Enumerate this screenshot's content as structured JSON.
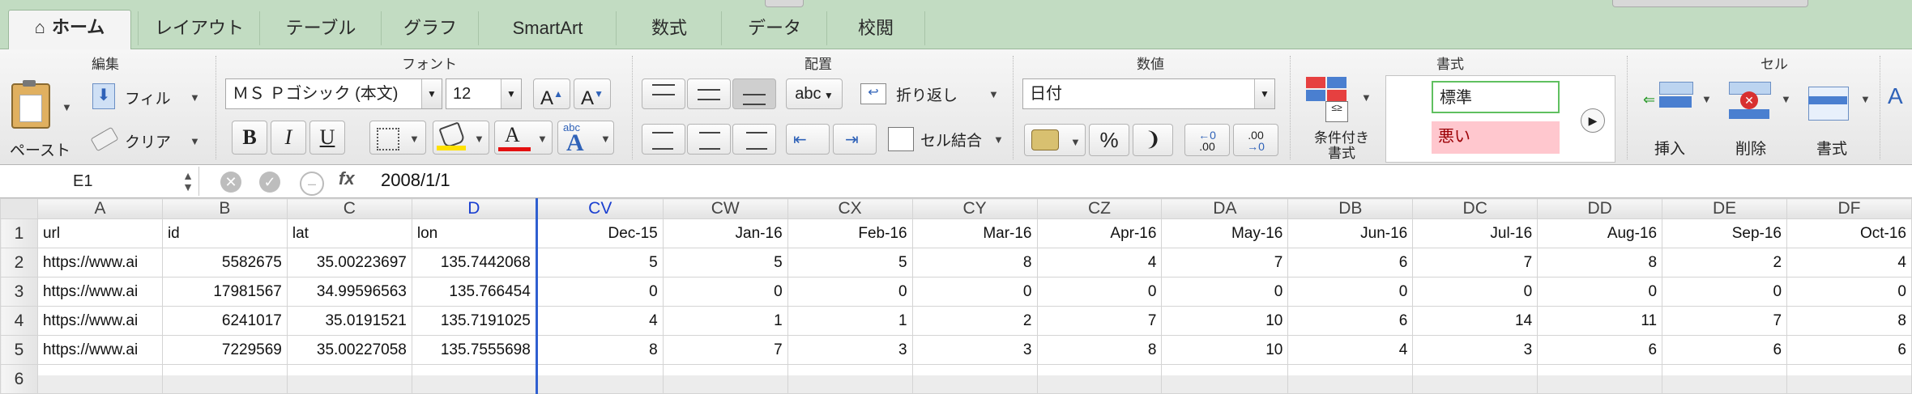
{
  "tabs": [
    "ホーム",
    "レイアウト",
    "テーブル",
    "グラフ",
    "SmartArt",
    "数式",
    "データ",
    "校閲"
  ],
  "ribbon": {
    "groups": {
      "edit": "編集",
      "font": "フォント",
      "align": "配置",
      "number": "数値",
      "styles": "書式",
      "cells": "セル"
    },
    "paste_label": "ペースト",
    "fill_label": "フィル",
    "clear_label": "クリア",
    "font_name": "ＭＳ Ｐゴシック (本文)",
    "font_size": "12",
    "grow_font": "A",
    "shrink_font": "A",
    "bold": "B",
    "italic": "I",
    "underline": "U",
    "font_color_letter": "A",
    "orientation_label": "abc",
    "wrap_label": "折り返し",
    "merge_label": "セル結合",
    "number_format": "日付",
    "percent": "%",
    "comma": "❩",
    "inc_decimal": ".00",
    "dec_decimal": ".00",
    "cond_format": "条件付き\n書式",
    "style_normal": "標準",
    "style_bad": "悪い",
    "insert_label": "挿入",
    "delete_label": "削除",
    "format_label": "書式"
  },
  "formula_bar": {
    "name_box": "E1",
    "fx": "fx",
    "content": "2008/1/1"
  },
  "sheet": {
    "columns": [
      "A",
      "B",
      "C",
      "D",
      "CV",
      "CW",
      "CX",
      "CY",
      "CZ",
      "DA",
      "DB",
      "DC",
      "DD",
      "DE",
      "DF"
    ],
    "selected_column": "D",
    "rows": [
      {
        "n": "1",
        "cells": [
          "url",
          "id",
          "lat",
          "lon",
          "Dec-15",
          "Jan-16",
          "Feb-16",
          "Mar-16",
          "Apr-16",
          "May-16",
          "Jun-16",
          "Jul-16",
          "Aug-16",
          "Sep-16",
          "Oct-16"
        ]
      },
      {
        "n": "2",
        "cells": [
          "https://www.ai",
          "5582675",
          "35.00223697",
          "135.7442068",
          "5",
          "5",
          "5",
          "8",
          "4",
          "7",
          "6",
          "7",
          "8",
          "2",
          "4"
        ]
      },
      {
        "n": "3",
        "cells": [
          "https://www.ai",
          "17981567",
          "34.99596563",
          "135.766454",
          "0",
          "0",
          "0",
          "0",
          "0",
          "0",
          "0",
          "0",
          "0",
          "0",
          "0"
        ]
      },
      {
        "n": "4",
        "cells": [
          "https://www.ai",
          "6241017",
          "35.0191521",
          "135.7191025",
          "4",
          "1",
          "1",
          "2",
          "7",
          "10",
          "6",
          "14",
          "11",
          "7",
          "8"
        ]
      },
      {
        "n": "5",
        "cells": [
          "https://www.ai",
          "7229569",
          "35.00227058",
          "135.7555698",
          "8",
          "7",
          "3",
          "3",
          "8",
          "10",
          "4",
          "3",
          "6",
          "6",
          "6"
        ]
      },
      {
        "n": "6",
        "cells": [
          "",
          "",
          "",
          "",
          "",
          "",
          "",
          "",
          "",
          "",
          "",
          "",
          "",
          "",
          ""
        ]
      }
    ]
  }
}
